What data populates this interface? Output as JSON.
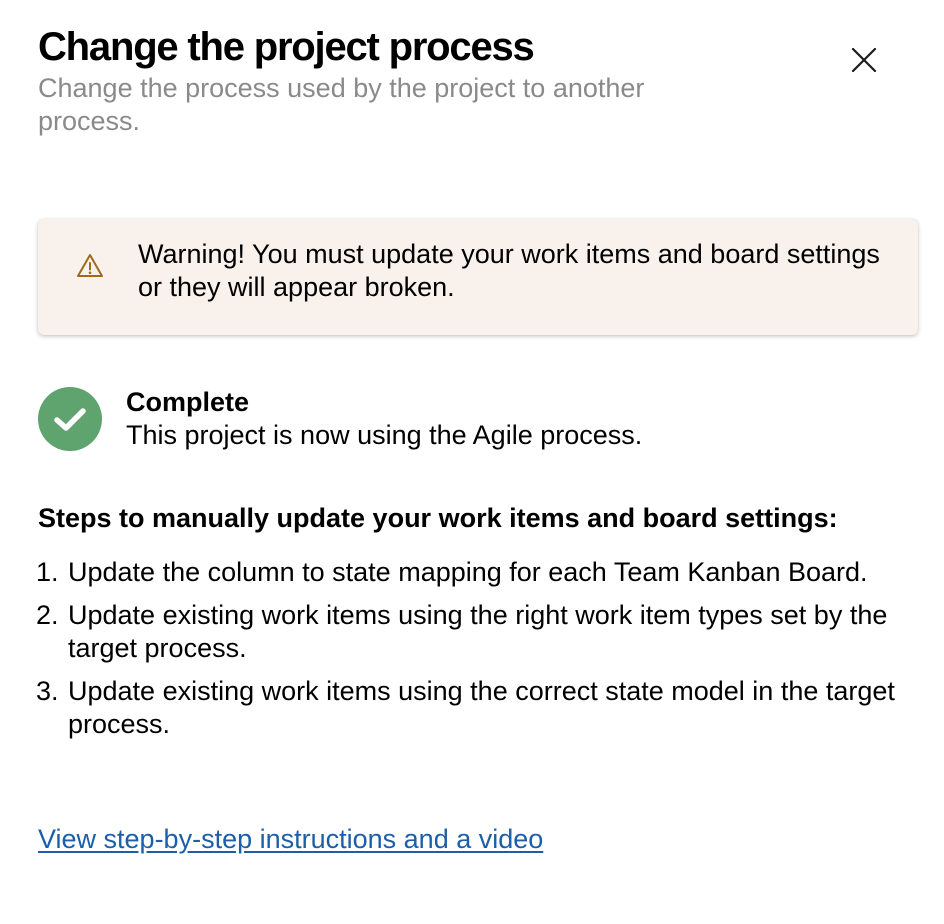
{
  "dialog": {
    "title": "Change the project process",
    "subtitle": "Change the process used by the project to another process.",
    "close_icon": "close-icon"
  },
  "warning": {
    "icon": "warning-icon",
    "text": "Warning! You must update your work items and board settings or they will appear broken.",
    "background_color": "#f9f1ec",
    "icon_color": "#a06a1a"
  },
  "status": {
    "icon": "checkmark-circle-icon",
    "icon_color": "#5fa36e",
    "title": "Complete",
    "message": "This project is now using the Agile process."
  },
  "steps": {
    "heading": "Steps to manually update your work items and board settings:",
    "items": [
      {
        "number": "1.",
        "text": "Update the column to state mapping for each Team Kanban Board."
      },
      {
        "number": "2.",
        "text": "Update existing work items using the right work item types set by the target process."
      },
      {
        "number": "3.",
        "text": "Update existing work items using the correct state model in the target process."
      }
    ]
  },
  "help_link": {
    "text": "View step-by-step instructions and a video",
    "color": "#1c5ea8"
  }
}
